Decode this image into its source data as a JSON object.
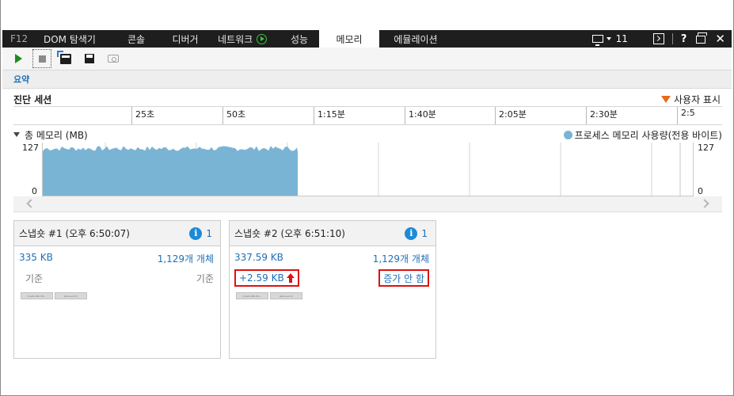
{
  "tabs": {
    "f12": "F12",
    "dom": "DOM 탐색기",
    "console": "콘솔",
    "debugger": "디버거",
    "network": "네트워크",
    "performance": "성능",
    "memory": "메모리",
    "emulation": "에뮬레이션",
    "active": "메모리"
  },
  "tabbar_right": {
    "target_count": "11"
  },
  "toolbar": {
    "icons": [
      "play-icon",
      "stop-icon",
      "import-icon",
      "save-icon",
      "camera-icon"
    ]
  },
  "summary": {
    "tab_label": "요약"
  },
  "session": {
    "title": "진단 세션",
    "user_marks_label": "사용자 표시",
    "ticks": [
      "25초",
      "50초",
      "1:15분",
      "1:40분",
      "2:05분",
      "2:30분",
      "2:5"
    ]
  },
  "memory_chart": {
    "title": "총 메모리 (MB)",
    "legend": "프로세스 메모리 사용량(전용 바이트)",
    "y_max": "127",
    "y_min": "0",
    "color": "#7ab4d4"
  },
  "chart_data": {
    "type": "area",
    "title": "총 메모리 (MB)",
    "ylim": [
      0,
      127
    ],
    "series": [
      {
        "name": "프로세스 메모리 사용량(전용 바이트)",
        "x_seconds_start": 0,
        "x_seconds_end": 70,
        "approx_level": 111,
        "peak": 117
      }
    ],
    "x_tick_labels": [
      "25초",
      "50초",
      "1:15분",
      "1:40분",
      "2:05분",
      "2:30분",
      "2:5"
    ],
    "legend_position": "top-right",
    "grid": true
  },
  "snapshots": [
    {
      "title": "스냅숏 #1 (오후 6:50:07)",
      "info_count": "1",
      "size": "335 KB",
      "objects": "1,129개 개체",
      "size_diff": "기준",
      "objects_diff": "기준",
      "mini_buttons": [
        "Create IBO Mo...",
        "Remove hli"
      ]
    },
    {
      "title": "스냅숏 #2 (오후 6:51:10)",
      "info_count": "1",
      "size": "337.59 KB",
      "objects": "1,129개 개체",
      "size_diff": "+2.59 KB",
      "objects_diff": "증가 안 함",
      "mini_buttons": [
        "Create IBO Mo...",
        "Remove hli"
      ],
      "highlight_color": "#e01010"
    }
  ]
}
